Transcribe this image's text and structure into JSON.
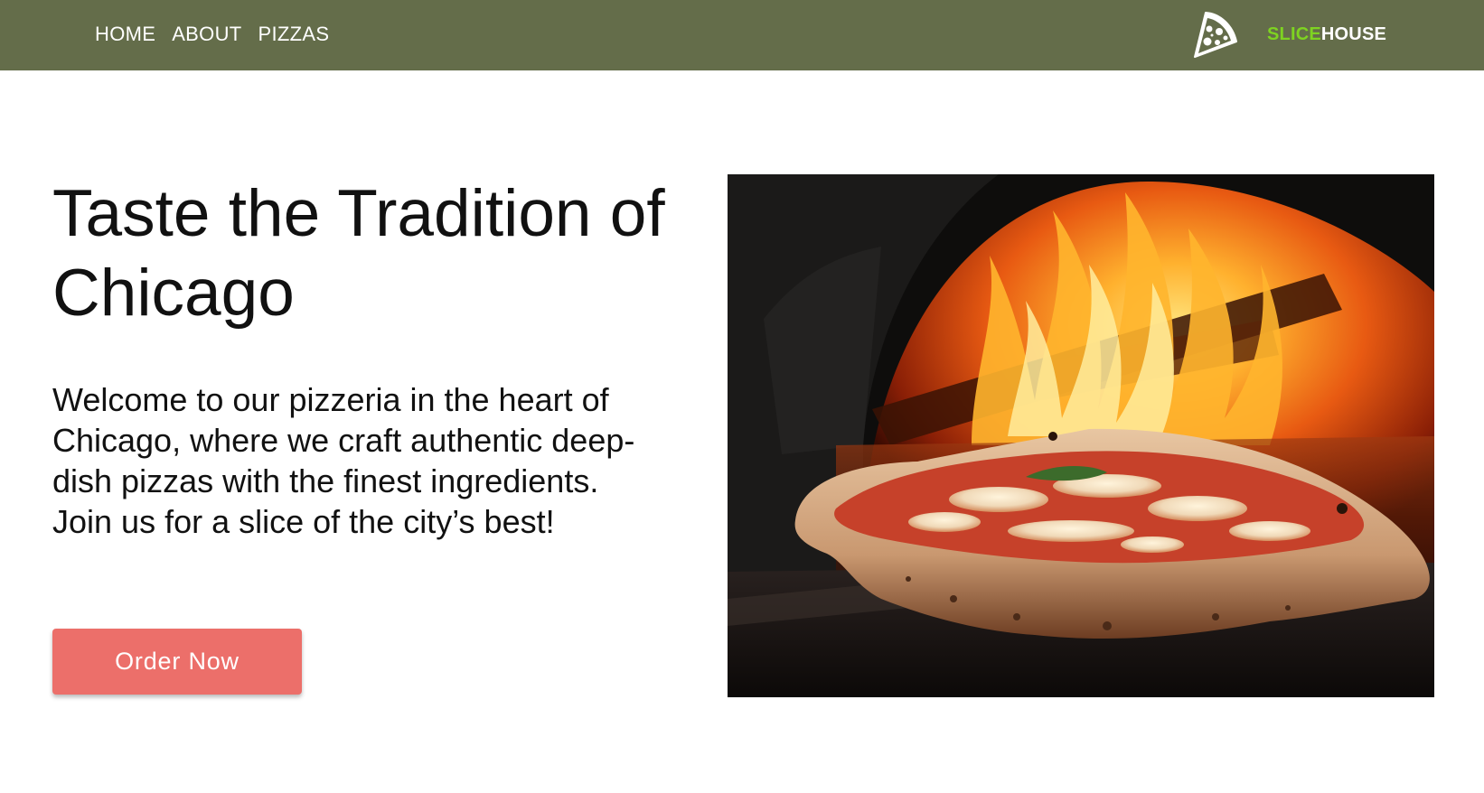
{
  "nav": {
    "links": [
      "HOME",
      "ABOUT",
      "PIZZAS"
    ]
  },
  "logo": {
    "brand_part1": "SLICE",
    "brand_part2": "HOUSE",
    "icon": "pizza-slice-icon"
  },
  "hero": {
    "title": "Taste the Tradition of Chicago",
    "description": "Welcome to our pizzeria in the heart of Chicago, where we craft authentic deep-dish pizzas with the finest ingredients. Join us for a slice of the city’s best!",
    "cta_label": "Order Now",
    "image": "pizza-in-wood-fired-oven"
  },
  "colors": {
    "navbar": "#646d4a",
    "brand_green": "#7ed321",
    "cta": "#ec6f6a"
  }
}
